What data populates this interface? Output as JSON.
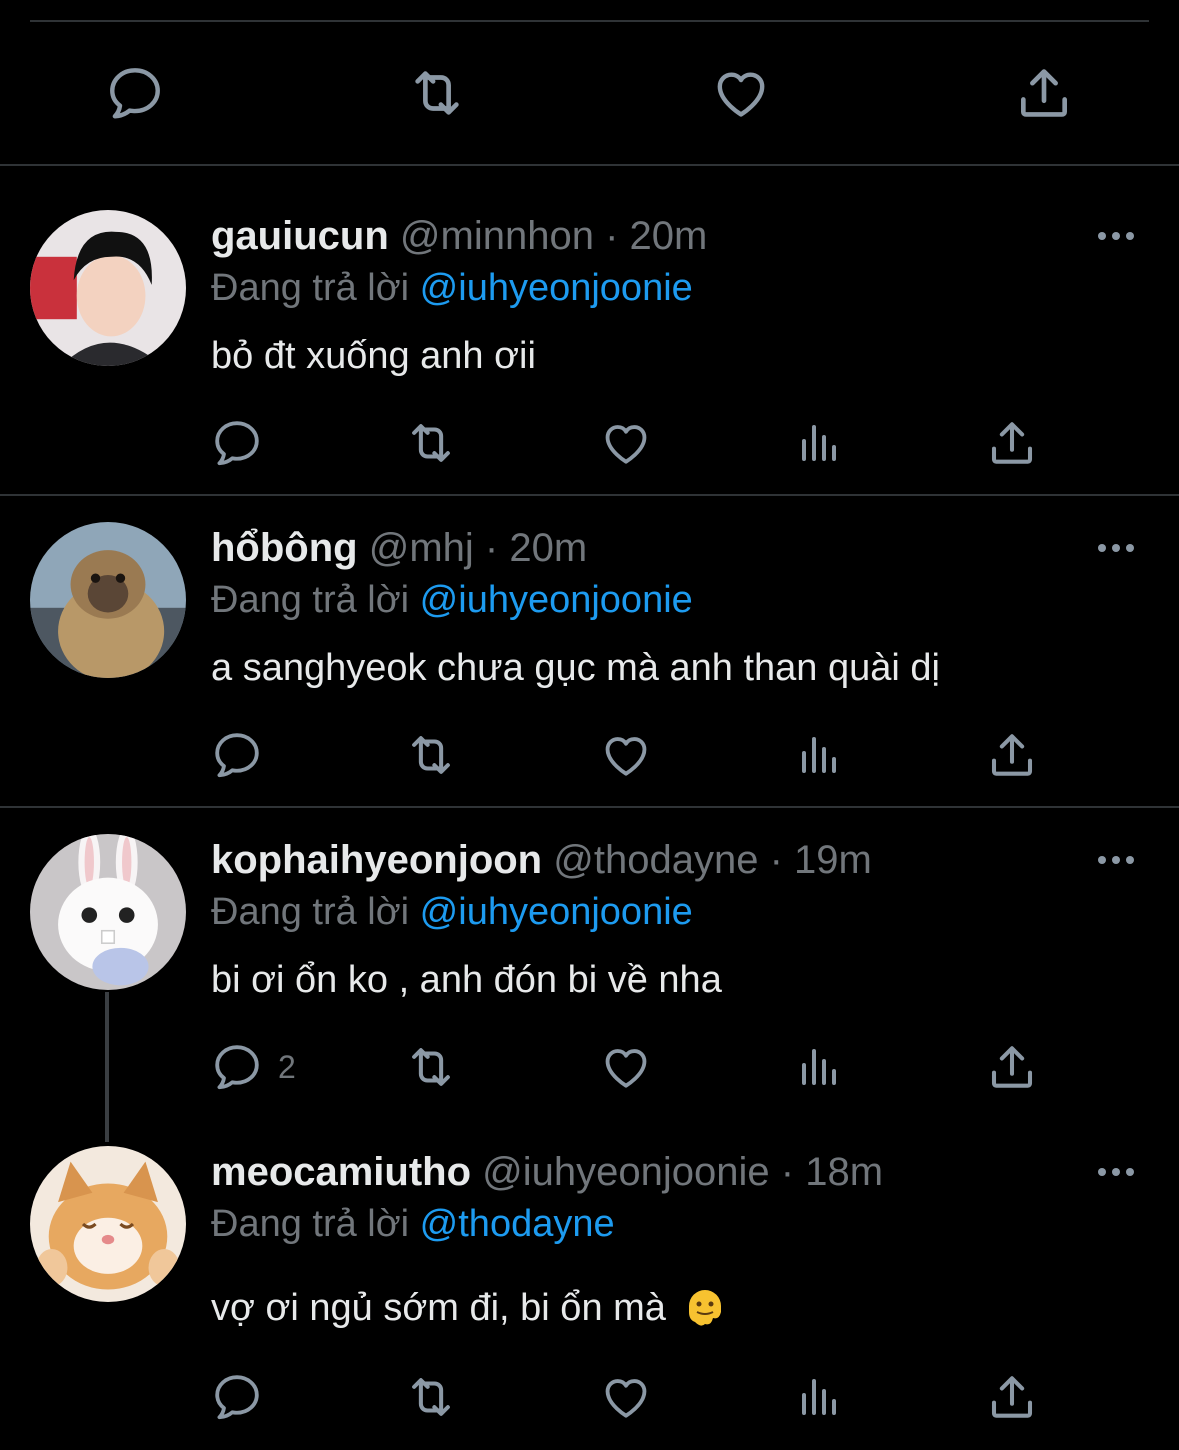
{
  "colors": {
    "background": "#000000",
    "text": "#e7e9ea",
    "muted": "#71767b",
    "accent": "#1d9bf0",
    "divider": "#2f3336"
  },
  "top_actions": {
    "icons": [
      "comment-icon",
      "retweet-icon",
      "like-icon",
      "share-icon"
    ]
  },
  "reply_label": "Đang trả lời",
  "tweets": [
    {
      "name": "gauiucun",
      "handle": "@minnhon",
      "sep": " · ",
      "time": "20m",
      "reply_to": "@iuhyeonjoonie",
      "text": "bỏ đt xuống anh ơii",
      "reply_count": ""
    },
    {
      "name": "hổbông",
      "handle": "@mhj",
      "sep": " · ",
      "time": "20m",
      "reply_to": "@iuhyeonjoonie",
      "text": "a sanghyeok  chưa gục mà anh than quài dị",
      "reply_count": ""
    },
    {
      "name": "kophaihyeonjoon",
      "handle": "@thodayne",
      "sep": " · ",
      "time": "19m",
      "reply_to": "@iuhyeonjoonie",
      "text": "bi ơi ổn ko , anh đón bi về nha",
      "reply_count": "2"
    },
    {
      "name": "meocamiutho",
      "handle": "@iuhyeonjoonie",
      "sep": " · ",
      "time": "18m",
      "reply_to": "@thodayne",
      "text": "vợ ơi ngủ sớm đi, bi ổn mà",
      "reply_count": ""
    }
  ]
}
